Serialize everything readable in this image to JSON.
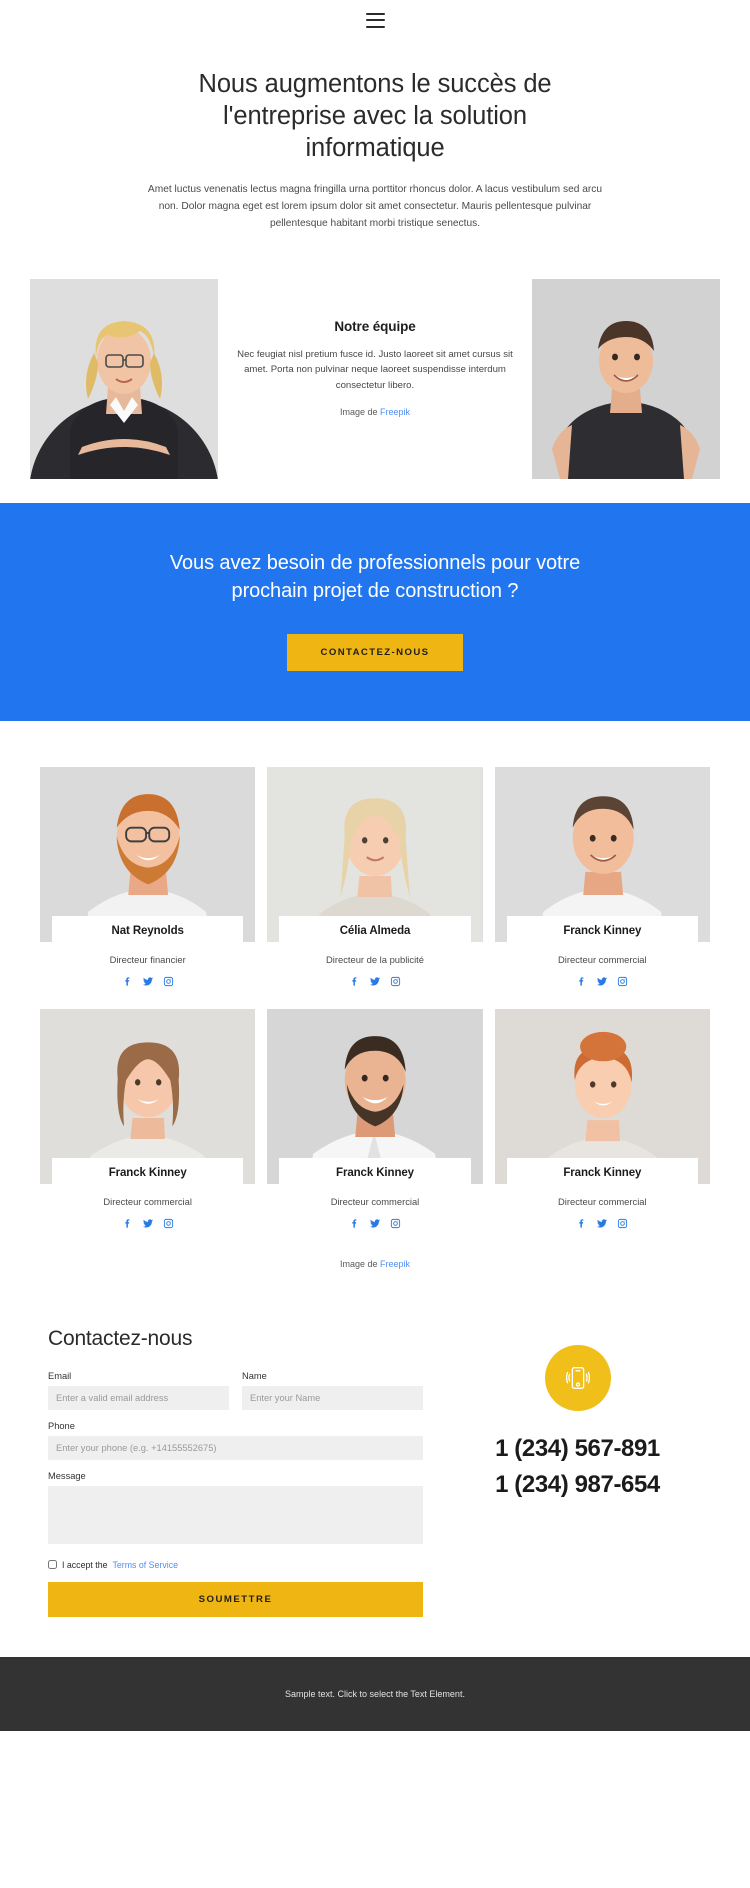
{
  "header": {
    "menu_icon": "hamburger-menu-icon"
  },
  "hero": {
    "title": "Nous augmentons le succès de l'entreprise avec la solution informatique",
    "paragraph": "Amet luctus venenatis lectus magna fringilla urna porttitor rhoncus dolor. A lacus vestibulum sed arcu non. Dolor magna eget est lorem ipsum dolor sit amet consectetur. Mauris pellentesque pulvinar pellentesque habitant morbi tristique senectus."
  },
  "team_intro": {
    "heading": "Notre équipe",
    "paragraph": "Nec feugiat nisl pretium fusce id. Justo laoreet sit amet cursus sit amet. Porta non pulvinar neque laoreet suspendisse interdum consectetur libero.",
    "credit_prefix": "Image de ",
    "credit_link": "Freepik"
  },
  "cta": {
    "heading": "Vous avez besoin de professionnels pour votre prochain projet de construction ?",
    "button_label": "CONTACTEZ-NOUS",
    "background_color": "#2176f0",
    "button_color": "#efb512"
  },
  "members": [
    {
      "name": "Nat Reynolds",
      "role": "Directeur financier"
    },
    {
      "name": "Célia Almeda",
      "role": "Directeur de la publicité"
    },
    {
      "name": "Franck Kinney",
      "role": "Directeur commercial"
    },
    {
      "name": "Franck Kinney",
      "role": "Directeur commercial"
    },
    {
      "name": "Franck Kinney",
      "role": "Directeur commercial"
    },
    {
      "name": "Franck Kinney",
      "role": "Directeur commercial"
    }
  ],
  "members_credit": {
    "prefix": "Image de ",
    "link": "Freepik"
  },
  "social_icons": [
    "facebook-icon",
    "twitter-icon",
    "instagram-icon"
  ],
  "contact": {
    "heading": "Contactez-nous",
    "email_label": "Email",
    "email_placeholder": "Enter a valid email address",
    "email_value": "",
    "name_label": "Name",
    "name_placeholder": "Enter your Name",
    "name_value": "",
    "phone_label": "Phone",
    "phone_placeholder": "Enter your phone (e.g. +14155552675)",
    "phone_value": "",
    "message_label": "Message",
    "message_placeholder": "",
    "message_value": "",
    "accept_text": "I accept the ",
    "terms_link": "Terms of Service",
    "submit_label": "SOUMETTRE",
    "phone_icon": "mobile-phone-ringing-icon",
    "phone_number_1": "1 (234) 567-891",
    "phone_number_2": "1 (234) 987-654"
  },
  "footer": {
    "text": "Sample text. Click to select the Text Element."
  }
}
